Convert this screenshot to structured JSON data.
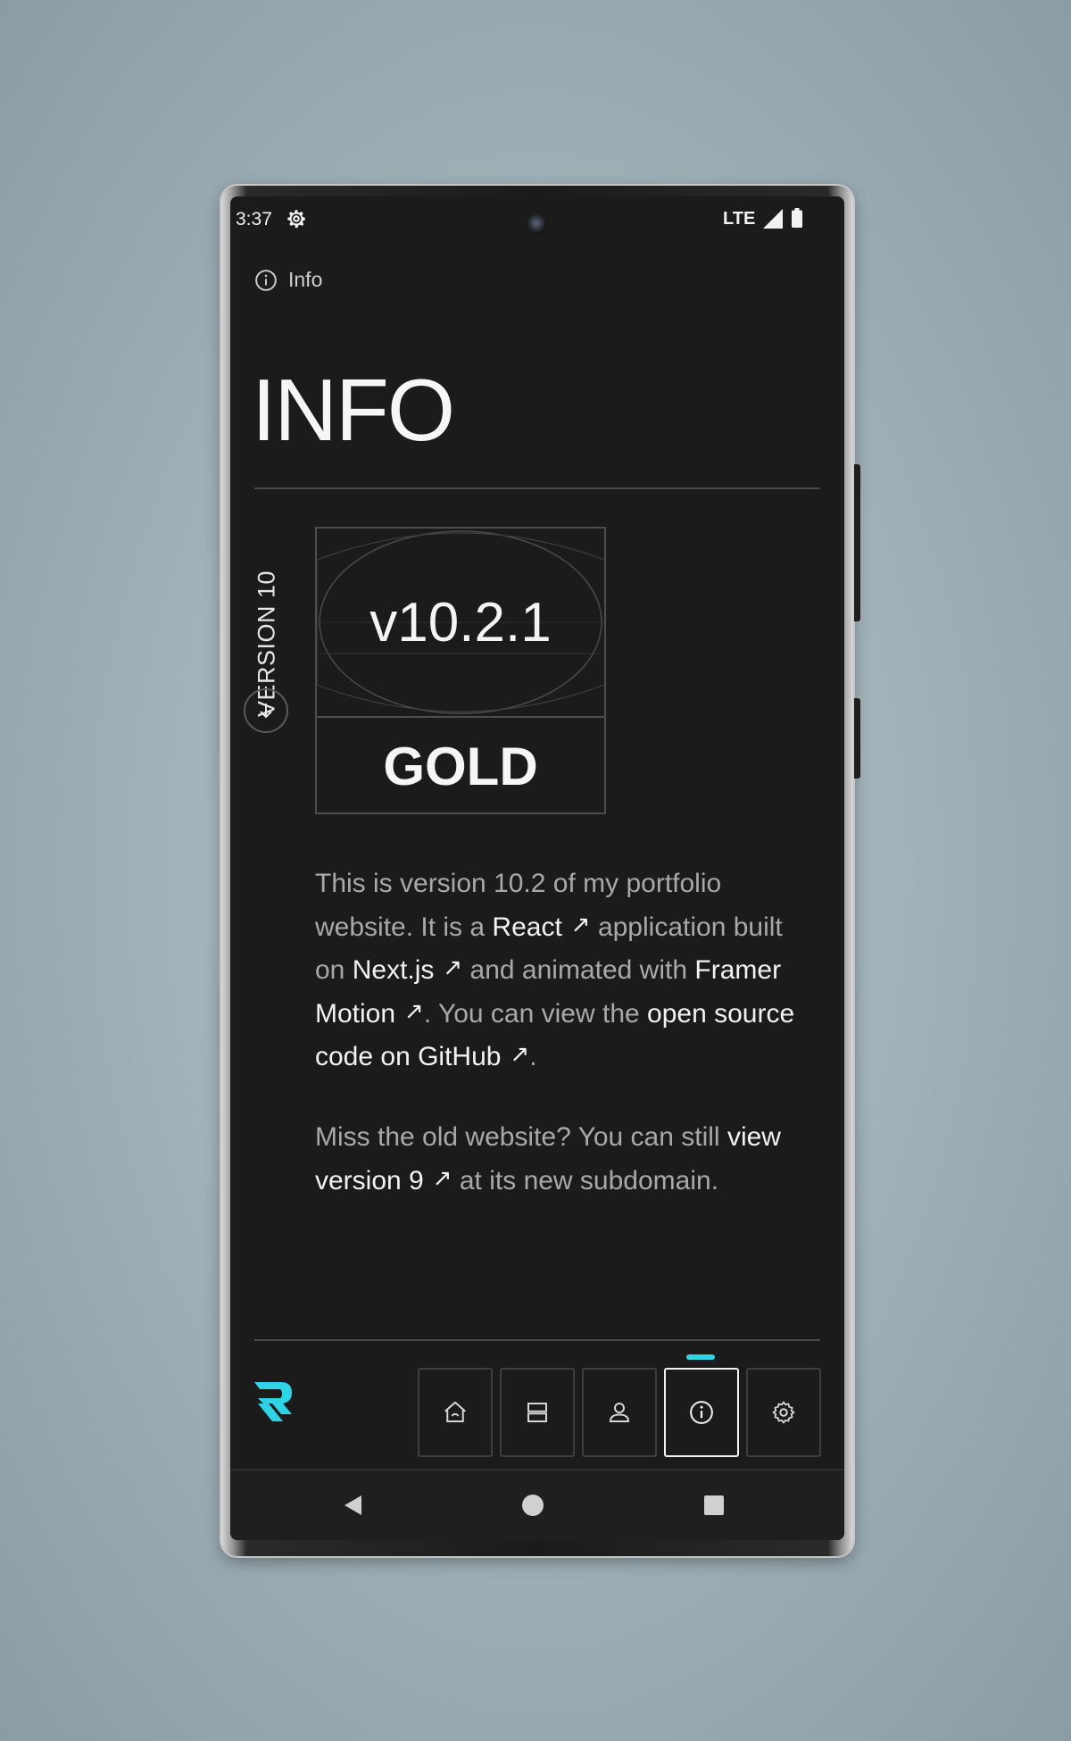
{
  "status_bar": {
    "time": "3:37",
    "network": "LTE",
    "icons": [
      "settings-gear-icon",
      "signal-icon",
      "battery-icon"
    ]
  },
  "header": {
    "label": "Info",
    "label_icon": "info-circle-icon",
    "title": "INFO"
  },
  "version": {
    "side_label": "VERSION 10",
    "number": "v10.2.1",
    "tier": "GOLD"
  },
  "body": {
    "p1": {
      "t1": "This is version 10.2 of my portfolio website. It is a",
      "link_react": "React",
      "t2": "application built on",
      "link_next": "Next.js",
      "t3": "and animated with",
      "link_framer": "Framer Motion",
      "t4": ". You can view the",
      "link_github": "open source code on GitHub",
      "t5": "."
    },
    "p2": {
      "t1": "Miss the old website? You can still",
      "link_v9": "view version 9",
      "t2": "at its new subdomain."
    },
    "external_link_glyph": "↗"
  },
  "nav": {
    "tabs": [
      {
        "icon": "home-icon"
      },
      {
        "icon": "projects-icon"
      },
      {
        "icon": "user-icon"
      },
      {
        "icon": "info-icon",
        "active": true
      },
      {
        "icon": "settings-icon"
      }
    ],
    "accent_color": "#2fd3e6"
  },
  "colors": {
    "screen_bg": "#1b1b1c",
    "text_primary": "#f2f2f2",
    "text_secondary": "#a9a9a9",
    "accent": "#2fd3e6",
    "page_bg": "#a3b3ba"
  }
}
